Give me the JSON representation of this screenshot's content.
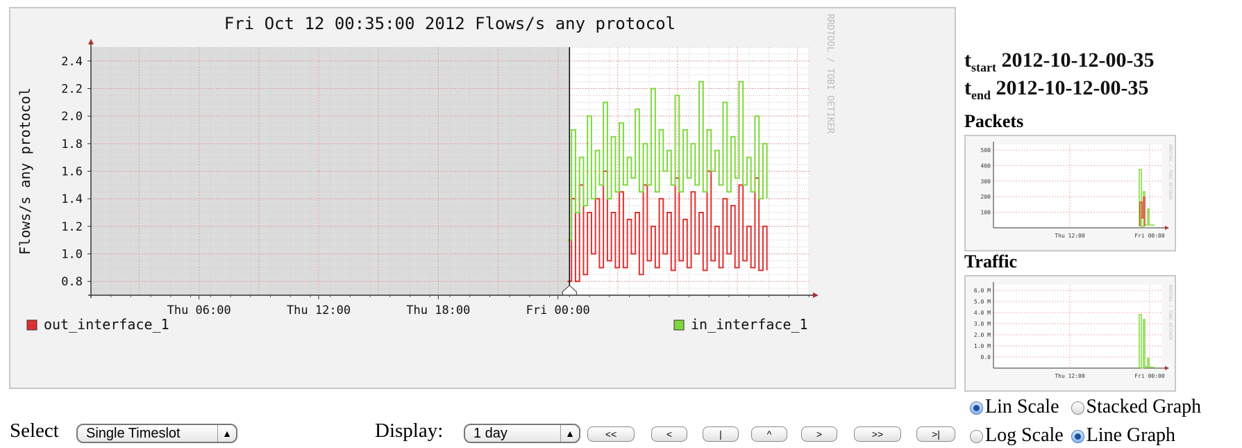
{
  "chart_data": {
    "type": "line",
    "title": "Fri Oct 12 00:35:00 2012 Flows/s any protocol",
    "ylabel": "Flows/s any protocol",
    "watermark": "RRDTOOL / TOBI OETIKER",
    "ylim": [
      0.7,
      2.5
    ],
    "yticks": [
      0.8,
      1.0,
      1.2,
      1.4,
      1.6,
      1.8,
      2.0,
      2.2,
      2.4
    ],
    "ytick_labels": [
      "0.8",
      "1.0",
      "1.2",
      "1.4",
      "1.6",
      "1.8",
      "2.0",
      "2.2",
      "2.4"
    ],
    "xlim": [
      0,
      36
    ],
    "x_unit": "hours since Thu 00:35",
    "xticks": [
      5.42,
      11.42,
      17.42,
      23.42
    ],
    "xtick_labels": [
      "Thu 06:00",
      "Thu 12:00",
      "Thu 18:00",
      "Fri 00:00"
    ],
    "cursor_x": 24.0,
    "grid": true,
    "legend_position": "bottom",
    "colors": {
      "out": "#e03030",
      "in": "#7fd83b",
      "inactive": "#dcdcdc"
    },
    "series": [
      {
        "name": "out_interface_1",
        "x": [
          23.9,
          24.1,
          24.3,
          24.5,
          24.7,
          24.9,
          25.1,
          25.3,
          25.5,
          25.7,
          25.9,
          26.1,
          26.3,
          26.5,
          26.7,
          26.9,
          27.1,
          27.3,
          27.5,
          27.7,
          27.9,
          28.1,
          28.3,
          28.5,
          28.7,
          28.9,
          29.1,
          29.3,
          29.5,
          29.7,
          29.9,
          30.1,
          30.3,
          30.5,
          30.7,
          30.9,
          31.1,
          31.3,
          31.5,
          31.7,
          31.9,
          32.1,
          32.3,
          32.5,
          32.7,
          32.9,
          33.1,
          33.3,
          33.5,
          33.7,
          33.9
        ],
        "values": [
          0.8,
          1.4,
          0.8,
          1.5,
          0.85,
          1.3,
          1.0,
          1.4,
          0.9,
          1.6,
          0.95,
          1.3,
          0.9,
          1.45,
          0.9,
          1.25,
          1.0,
          1.3,
          0.85,
          1.5,
          0.95,
          1.2,
          0.9,
          1.4,
          1.0,
          1.3,
          0.88,
          1.55,
          0.95,
          1.25,
          0.9,
          1.45,
          1.0,
          1.3,
          0.88,
          1.6,
          0.95,
          1.2,
          0.9,
          1.4,
          1.0,
          1.35,
          0.9,
          1.5,
          0.95,
          1.2,
          0.9,
          1.55,
          0.88,
          1.2,
          0.88
        ]
      },
      {
        "name": "in_interface_1",
        "x": [
          23.9,
          24.1,
          24.3,
          24.5,
          24.7,
          24.9,
          25.1,
          25.3,
          25.5,
          25.7,
          25.9,
          26.1,
          26.3,
          26.5,
          26.7,
          26.9,
          27.1,
          27.3,
          27.5,
          27.7,
          27.9,
          28.1,
          28.3,
          28.5,
          28.7,
          28.9,
          29.1,
          29.3,
          29.5,
          29.7,
          29.9,
          30.1,
          30.3,
          30.5,
          30.7,
          30.9,
          31.1,
          31.3,
          31.5,
          31.7,
          31.9,
          32.1,
          32.3,
          32.5,
          32.7,
          32.9,
          33.1,
          33.3,
          33.5,
          33.7,
          33.9
        ],
        "values": [
          1.1,
          1.9,
          1.3,
          1.7,
          1.35,
          2.0,
          1.4,
          1.75,
          1.5,
          2.1,
          1.4,
          1.85,
          1.45,
          1.95,
          1.5,
          1.7,
          1.55,
          2.05,
          1.45,
          1.8,
          1.5,
          2.2,
          1.45,
          1.9,
          1.6,
          1.75,
          1.5,
          2.15,
          1.45,
          1.9,
          1.55,
          1.8,
          1.5,
          2.25,
          1.45,
          1.9,
          1.6,
          1.75,
          1.5,
          2.1,
          1.45,
          1.85,
          1.55,
          2.25,
          1.5,
          1.7,
          1.45,
          2.0,
          1.4,
          1.8,
          1.4
        ]
      }
    ]
  },
  "side": {
    "tstart_label": "t",
    "tstart_sub": "start",
    "tstart_value": "2012-10-12-00-35",
    "tend_label": "t",
    "tend_sub": "end",
    "tend_value": "2012-10-12-00-35",
    "packets_title": "Packets",
    "traffic_title": "Traffic",
    "packets_thumb": {
      "ytick_labels": [
        "500",
        "400",
        "300",
        "200",
        "100"
      ],
      "xtick_labels": [
        "Thu 12:00",
        "Fri 00:00"
      ]
    },
    "traffic_thumb": {
      "ytick_labels": [
        "6.0 M",
        "5.0 M",
        "4.0 M",
        "3.0 M",
        "2.0 M",
        "1.0 M",
        "0.0"
      ],
      "xtick_labels": [
        "Thu 12:00",
        "Fri 00:00"
      ]
    },
    "options": {
      "lin_scale": "Lin Scale",
      "stacked_graph": "Stacked Graph",
      "log_scale": "Log Scale",
      "line_graph": "Line Graph",
      "lin_checked": true,
      "stacked_checked": false,
      "log_checked": false,
      "line_checked": true
    }
  },
  "controls": {
    "select_label": "Select",
    "select_value": "Single Timeslot",
    "display_label": "Display:",
    "display_value": "1 day",
    "nav_buttons": [
      "<<",
      "<",
      "|",
      "^",
      ">",
      ">>",
      ">|"
    ]
  }
}
